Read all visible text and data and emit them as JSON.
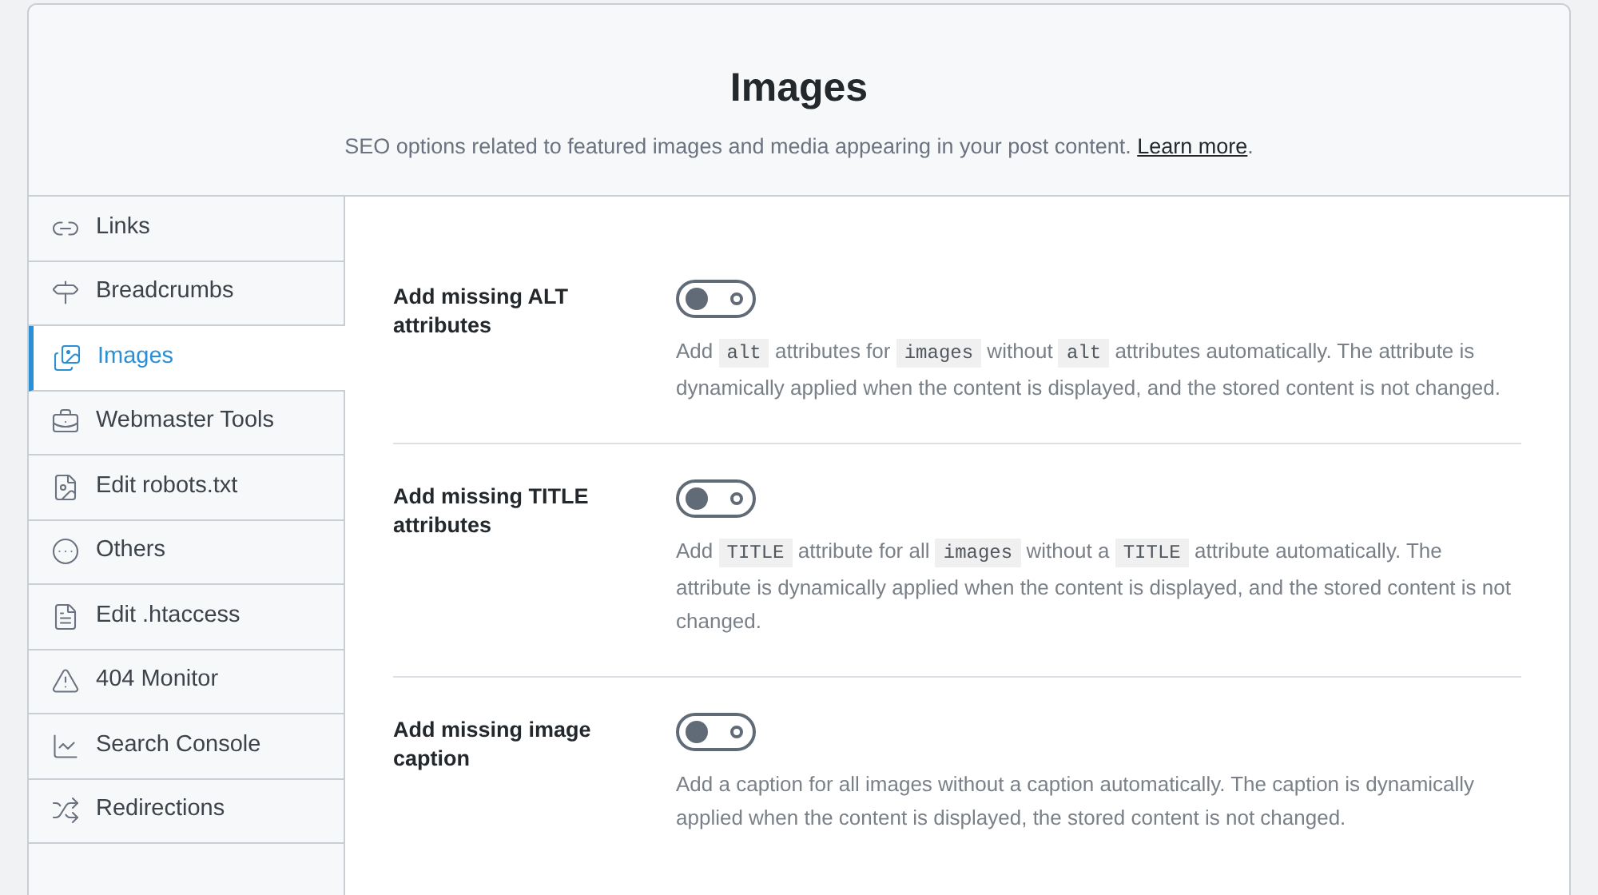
{
  "header": {
    "title": "Images",
    "subtitle": {
      "text": "SEO options related to featured images and media appearing in your post content. ",
      "link": "Learn more",
      "after": "."
    }
  },
  "sidebar": {
    "items": [
      {
        "label": "Links",
        "selected": false
      },
      {
        "label": "Breadcrumbs",
        "selected": false
      },
      {
        "label": "Images",
        "selected": true
      },
      {
        "label": "Webmaster Tools",
        "selected": false
      },
      {
        "label": "Edit robots.txt",
        "selected": false
      },
      {
        "label": "Others",
        "selected": false
      },
      {
        "label": "Edit .htaccess",
        "selected": false
      },
      {
        "label": "404 Monitor",
        "selected": false
      },
      {
        "label": "Search Console",
        "selected": false
      },
      {
        "label": "Redirections",
        "selected": false
      }
    ]
  },
  "settings": [
    {
      "label": "Add missing ALT attributes",
      "on": false,
      "description": [
        {
          "kind": "text",
          "text": "Add "
        },
        {
          "kind": "code",
          "text": "alt"
        },
        {
          "kind": "text",
          "text": " attributes for "
        },
        {
          "kind": "code",
          "text": "images"
        },
        {
          "kind": "text",
          "text": " without "
        },
        {
          "kind": "code",
          "text": "alt"
        },
        {
          "kind": "text",
          "text": " attributes automatically. The attribute is dynamically applied when the content is displayed, and the stored content is not changed."
        }
      ]
    },
    {
      "label": "Add missing TITLE attributes",
      "on": false,
      "description": [
        {
          "kind": "text",
          "text": "Add "
        },
        {
          "kind": "code",
          "text": "TITLE"
        },
        {
          "kind": "text",
          "text": " attribute for all "
        },
        {
          "kind": "code",
          "text": "images"
        },
        {
          "kind": "text",
          "text": " without a "
        },
        {
          "kind": "code",
          "text": "TITLE"
        },
        {
          "kind": "text",
          "text": " attribute automatically. The attribute is dynamically applied when the content is displayed, and the stored content is not changed."
        }
      ]
    },
    {
      "label": "Add missing image caption",
      "on": false,
      "description": [
        {
          "kind": "text",
          "text": "Add a caption for all images without a caption automatically. The caption is dynamically applied when the content is displayed, the stored content is not changed."
        }
      ]
    }
  ]
}
